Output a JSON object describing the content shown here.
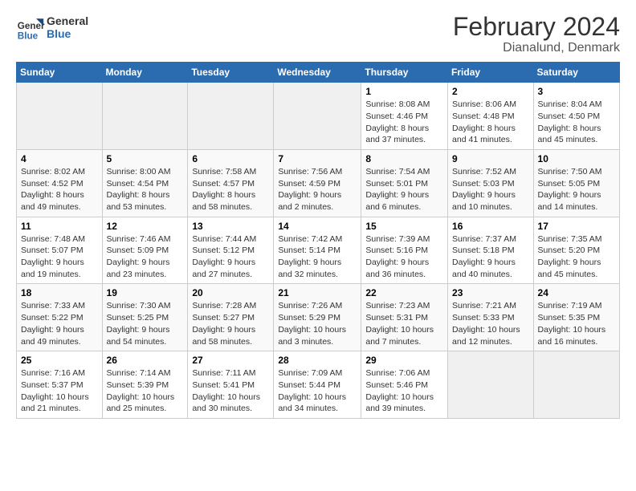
{
  "header": {
    "logo_text_1": "General",
    "logo_text_2": "Blue",
    "title": "February 2024",
    "subtitle": "Dianalund, Denmark"
  },
  "calendar": {
    "days_of_week": [
      "Sunday",
      "Monday",
      "Tuesday",
      "Wednesday",
      "Thursday",
      "Friday",
      "Saturday"
    ],
    "weeks": [
      [
        {
          "day": "",
          "info": ""
        },
        {
          "day": "",
          "info": ""
        },
        {
          "day": "",
          "info": ""
        },
        {
          "day": "",
          "info": ""
        },
        {
          "day": "1",
          "info": "Sunrise: 8:08 AM\nSunset: 4:46 PM\nDaylight: 8 hours\nand 37 minutes."
        },
        {
          "day": "2",
          "info": "Sunrise: 8:06 AM\nSunset: 4:48 PM\nDaylight: 8 hours\nand 41 minutes."
        },
        {
          "day": "3",
          "info": "Sunrise: 8:04 AM\nSunset: 4:50 PM\nDaylight: 8 hours\nand 45 minutes."
        }
      ],
      [
        {
          "day": "4",
          "info": "Sunrise: 8:02 AM\nSunset: 4:52 PM\nDaylight: 8 hours\nand 49 minutes."
        },
        {
          "day": "5",
          "info": "Sunrise: 8:00 AM\nSunset: 4:54 PM\nDaylight: 8 hours\nand 53 minutes."
        },
        {
          "day": "6",
          "info": "Sunrise: 7:58 AM\nSunset: 4:57 PM\nDaylight: 8 hours\nand 58 minutes."
        },
        {
          "day": "7",
          "info": "Sunrise: 7:56 AM\nSunset: 4:59 PM\nDaylight: 9 hours\nand 2 minutes."
        },
        {
          "day": "8",
          "info": "Sunrise: 7:54 AM\nSunset: 5:01 PM\nDaylight: 9 hours\nand 6 minutes."
        },
        {
          "day": "9",
          "info": "Sunrise: 7:52 AM\nSunset: 5:03 PM\nDaylight: 9 hours\nand 10 minutes."
        },
        {
          "day": "10",
          "info": "Sunrise: 7:50 AM\nSunset: 5:05 PM\nDaylight: 9 hours\nand 14 minutes."
        }
      ],
      [
        {
          "day": "11",
          "info": "Sunrise: 7:48 AM\nSunset: 5:07 PM\nDaylight: 9 hours\nand 19 minutes."
        },
        {
          "day": "12",
          "info": "Sunrise: 7:46 AM\nSunset: 5:09 PM\nDaylight: 9 hours\nand 23 minutes."
        },
        {
          "day": "13",
          "info": "Sunrise: 7:44 AM\nSunset: 5:12 PM\nDaylight: 9 hours\nand 27 minutes."
        },
        {
          "day": "14",
          "info": "Sunrise: 7:42 AM\nSunset: 5:14 PM\nDaylight: 9 hours\nand 32 minutes."
        },
        {
          "day": "15",
          "info": "Sunrise: 7:39 AM\nSunset: 5:16 PM\nDaylight: 9 hours\nand 36 minutes."
        },
        {
          "day": "16",
          "info": "Sunrise: 7:37 AM\nSunset: 5:18 PM\nDaylight: 9 hours\nand 40 minutes."
        },
        {
          "day": "17",
          "info": "Sunrise: 7:35 AM\nSunset: 5:20 PM\nDaylight: 9 hours\nand 45 minutes."
        }
      ],
      [
        {
          "day": "18",
          "info": "Sunrise: 7:33 AM\nSunset: 5:22 PM\nDaylight: 9 hours\nand 49 minutes."
        },
        {
          "day": "19",
          "info": "Sunrise: 7:30 AM\nSunset: 5:25 PM\nDaylight: 9 hours\nand 54 minutes."
        },
        {
          "day": "20",
          "info": "Sunrise: 7:28 AM\nSunset: 5:27 PM\nDaylight: 9 hours\nand 58 minutes."
        },
        {
          "day": "21",
          "info": "Sunrise: 7:26 AM\nSunset: 5:29 PM\nDaylight: 10 hours\nand 3 minutes."
        },
        {
          "day": "22",
          "info": "Sunrise: 7:23 AM\nSunset: 5:31 PM\nDaylight: 10 hours\nand 7 minutes."
        },
        {
          "day": "23",
          "info": "Sunrise: 7:21 AM\nSunset: 5:33 PM\nDaylight: 10 hours\nand 12 minutes."
        },
        {
          "day": "24",
          "info": "Sunrise: 7:19 AM\nSunset: 5:35 PM\nDaylight: 10 hours\nand 16 minutes."
        }
      ],
      [
        {
          "day": "25",
          "info": "Sunrise: 7:16 AM\nSunset: 5:37 PM\nDaylight: 10 hours\nand 21 minutes."
        },
        {
          "day": "26",
          "info": "Sunrise: 7:14 AM\nSunset: 5:39 PM\nDaylight: 10 hours\nand 25 minutes."
        },
        {
          "day": "27",
          "info": "Sunrise: 7:11 AM\nSunset: 5:41 PM\nDaylight: 10 hours\nand 30 minutes."
        },
        {
          "day": "28",
          "info": "Sunrise: 7:09 AM\nSunset: 5:44 PM\nDaylight: 10 hours\nand 34 minutes."
        },
        {
          "day": "29",
          "info": "Sunrise: 7:06 AM\nSunset: 5:46 PM\nDaylight: 10 hours\nand 39 minutes."
        },
        {
          "day": "",
          "info": ""
        },
        {
          "day": "",
          "info": ""
        }
      ]
    ]
  }
}
